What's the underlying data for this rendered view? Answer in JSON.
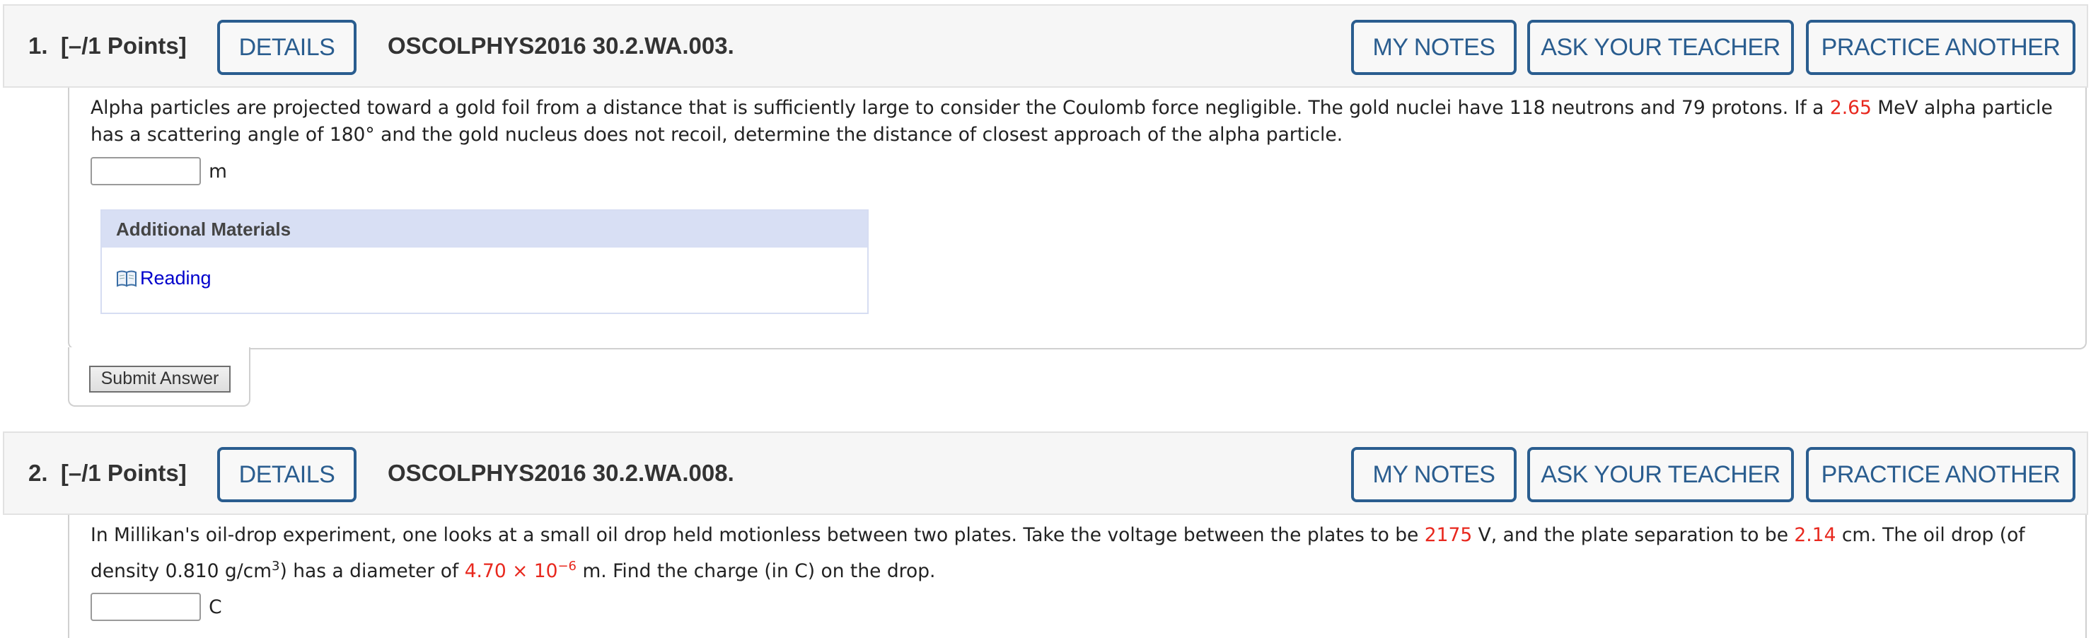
{
  "questions": [
    {
      "number": "1.",
      "points": "[–/1 Points]",
      "details_label": "DETAILS",
      "code": "OSCOLPHYS2016 30.2.WA.003.",
      "my_notes_label": "MY NOTES",
      "ask_teacher_label": "ASK YOUR TEACHER",
      "practice_label": "PRACTICE ANOTHER",
      "text": {
        "line1_a": "Alpha particles are projected toward a gold foil from a distance that is sufficiently large to consider the Coulomb force negligible. The gold nuclei have 118 neutrons and 79 protons. If a ",
        "line1_value": "2.65",
        "line1_b": " MeV alpha particle",
        "line2": "has a scattering angle of 180° and the gold nucleus does not recoil, determine the distance of closest approach of the alpha particle."
      },
      "answer": {
        "value": "",
        "unit": "m"
      },
      "additional_materials": {
        "title": "Additional Materials",
        "items": [
          {
            "icon": "book-icon",
            "label": "Reading"
          }
        ]
      },
      "submit_label": "Submit Answer"
    },
    {
      "number": "2.",
      "points": "[–/1 Points]",
      "details_label": "DETAILS",
      "code": "OSCOLPHYS2016 30.2.WA.008.",
      "my_notes_label": "MY NOTES",
      "ask_teacher_label": "ASK YOUR TEACHER",
      "practice_label": "PRACTICE ANOTHER",
      "text": {
        "line1_a": "In Millikan's oil-drop experiment, one looks at a small oil drop held motionless between two plates. Take the voltage between the plates to be ",
        "voltage": "2175",
        "line1_b": " V, and the plate separation to be ",
        "separation": "2.14",
        "line1_c": " cm. The oil drop (of",
        "line2_a": "density 0.810 g/cm",
        "line2_sup": "3",
        "line2_b": ") has a diameter of ",
        "diameter_mantissa": "4.70 × 10",
        "diameter_exp": "−6",
        "line2_c": " m. Find the charge (in C) on the drop."
      },
      "answer": {
        "value": "",
        "unit": "C"
      }
    }
  ],
  "colors": {
    "accent": "#2a5d8f",
    "highlight": "#e8281e",
    "link": "#0000cc",
    "header_bg": "#f6f6f6",
    "materials_bg": "#d8dff4"
  }
}
